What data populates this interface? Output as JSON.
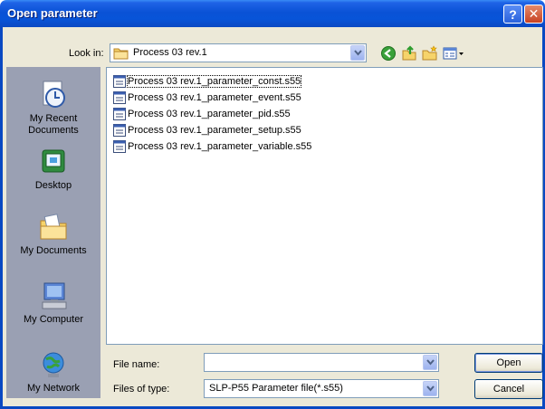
{
  "window": {
    "title": "Open parameter",
    "help_symbol": "?",
    "close_symbol": "✕"
  },
  "lookin": {
    "label": "Look in:",
    "value": "Process 03 rev.1"
  },
  "places": [
    {
      "label": "My Recent Documents",
      "icon": "recent-documents-icon"
    },
    {
      "label": "Desktop",
      "icon": "desktop-icon"
    },
    {
      "label": "My Documents",
      "icon": "my-documents-icon"
    },
    {
      "label": "My Computer",
      "icon": "my-computer-icon"
    },
    {
      "label": "My Network",
      "icon": "my-network-icon"
    }
  ],
  "files": [
    "Process 03 rev.1_parameter_const.s55",
    "Process 03 rev.1_parameter_event.s55",
    "Process 03 rev.1_parameter_pid.s55",
    "Process 03 rev.1_parameter_setup.s55",
    "Process 03 rev.1_parameter_variable.s55"
  ],
  "filename": {
    "label": "File name:",
    "value": ""
  },
  "filetype": {
    "label": "Files of type:",
    "value": "SLP-P55 Parameter file(*.s55)"
  },
  "buttons": {
    "open": "Open",
    "cancel": "Cancel"
  },
  "colors": {
    "titlebar": "#0a52d6",
    "dialog_bg": "#ece9d8",
    "places_bg": "#9aa0b3",
    "field_border": "#7f9db9"
  }
}
